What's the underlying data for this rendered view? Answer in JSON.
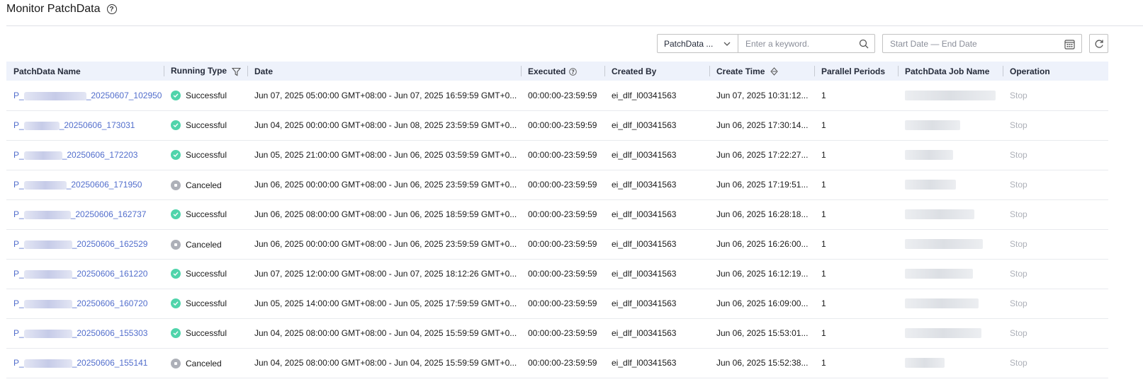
{
  "header": {
    "title": "Monitor PatchData"
  },
  "toolbar": {
    "type_select_value": "PatchData ...",
    "keyword_placeholder": "Enter a keyword.",
    "date_range_placeholder": "Start Date — End Date"
  },
  "table": {
    "columns": {
      "name": "PatchData Name",
      "running_type": "Running Type",
      "date": "Date",
      "executed": "Executed",
      "created_by": "Created By",
      "create_time": "Create Time",
      "parallel_periods": "Parallel Periods",
      "job_name": "PatchData Job Name",
      "operation": "Operation"
    },
    "rows": [
      {
        "name_prefix": "P_",
        "name_suffix": "_20250607_102950",
        "status": "Successful",
        "status_kind": "ok",
        "date": "Jun 07, 2025 05:00:00 GMT+08:00 - Jun 07, 2025 16:59:59 GMT+0...",
        "executed": "00:00:00-23:59:59",
        "created_by": "ei_dlf_l00341563",
        "create_time": "Jun 07, 2025 10:31:12...",
        "parallel": "1",
        "operation": "Stop"
      },
      {
        "name_prefix": "P_",
        "name_suffix": "_20250606_173031",
        "status": "Successful",
        "status_kind": "ok",
        "date": "Jun 04, 2025 00:00:00 GMT+08:00 - Jun 08, 2025 23:59:59 GMT+0...",
        "executed": "00:00:00-23:59:59",
        "created_by": "ei_dlf_l00341563",
        "create_time": "Jun 06, 2025 17:30:14...",
        "parallel": "1",
        "operation": "Stop"
      },
      {
        "name_prefix": "P_",
        "name_suffix": "_20250606_172203",
        "status": "Successful",
        "status_kind": "ok",
        "date": "Jun 05, 2025 21:00:00 GMT+08:00 - Jun 06, 2025 03:59:59 GMT+0...",
        "executed": "00:00:00-23:59:59",
        "created_by": "ei_dlf_l00341563",
        "create_time": "Jun 06, 2025 17:22:27...",
        "parallel": "1",
        "operation": "Stop"
      },
      {
        "name_prefix": "P_",
        "name_suffix": "_20250606_171950",
        "status": "Canceled",
        "status_kind": "cancel",
        "date": "Jun 06, 2025 00:00:00 GMT+08:00 - Jun 06, 2025 23:59:59 GMT+0...",
        "executed": "00:00:00-23:59:59",
        "created_by": "ei_dlf_l00341563",
        "create_time": "Jun 06, 2025 17:19:51...",
        "parallel": "1",
        "operation": "Stop"
      },
      {
        "name_prefix": "P_",
        "name_suffix": "_20250606_162737",
        "status": "Successful",
        "status_kind": "ok",
        "date": "Jun 06, 2025 08:00:00 GMT+08:00 - Jun 06, 2025 18:59:59 GMT+0...",
        "executed": "00:00:00-23:59:59",
        "created_by": "ei_dlf_l00341563",
        "create_time": "Jun 06, 2025 16:28:18...",
        "parallel": "1",
        "operation": "Stop"
      },
      {
        "name_prefix": "P_",
        "name_suffix": "_20250606_162529",
        "status": "Canceled",
        "status_kind": "cancel",
        "date": "Jun 06, 2025 00:00:00 GMT+08:00 - Jun 06, 2025 23:59:59 GMT+0...",
        "executed": "00:00:00-23:59:59",
        "created_by": "ei_dlf_l00341563",
        "create_time": "Jun 06, 2025 16:26:00...",
        "parallel": "1",
        "operation": "Stop"
      },
      {
        "name_prefix": "P_",
        "name_suffix": "_20250606_161220",
        "status": "Successful",
        "status_kind": "ok",
        "date": "Jun 07, 2025 12:00:00 GMT+08:00 - Jun 07, 2025 18:12:26 GMT+0...",
        "executed": "00:00:00-23:59:59",
        "created_by": "ei_dlf_l00341563",
        "create_time": "Jun 06, 2025 16:12:19...",
        "parallel": "1",
        "operation": "Stop"
      },
      {
        "name_prefix": "P_",
        "name_suffix": "_20250606_160720",
        "status": "Successful",
        "status_kind": "ok",
        "date": "Jun 05, 2025 14:00:00 GMT+08:00 - Jun 05, 2025 17:59:59 GMT+0...",
        "executed": "00:00:00-23:59:59",
        "created_by": "ei_dlf_l00341563",
        "create_time": "Jun 06, 2025 16:09:00...",
        "parallel": "1",
        "operation": "Stop"
      },
      {
        "name_prefix": "P_",
        "name_suffix": "_20250606_155303",
        "status": "Successful",
        "status_kind": "ok",
        "date": "Jun 04, 2025 08:00:00 GMT+08:00 - Jun 04, 2025 15:59:59 GMT+0...",
        "executed": "00:00:00-23:59:59",
        "created_by": "ei_dlf_l00341563",
        "create_time": "Jun 06, 2025 15:53:01...",
        "parallel": "1",
        "operation": "Stop"
      },
      {
        "name_prefix": "P_",
        "name_suffix": "_20250606_155141",
        "status": "Canceled",
        "status_kind": "cancel",
        "date": "Jun 04, 2025 08:00:00 GMT+08:00 - Jun 04, 2025 15:59:59 GMT+0...",
        "executed": "00:00:00-23:59:59",
        "created_by": "ei_dlf_l00341563",
        "create_time": "Jun 06, 2025 15:52:38...",
        "parallel": "1",
        "operation": "Stop"
      }
    ]
  },
  "colors": {
    "link": "#526ecc",
    "success": "#50d4ab",
    "canceled": "#adb0b8",
    "header_bg": "#eef2fb"
  }
}
